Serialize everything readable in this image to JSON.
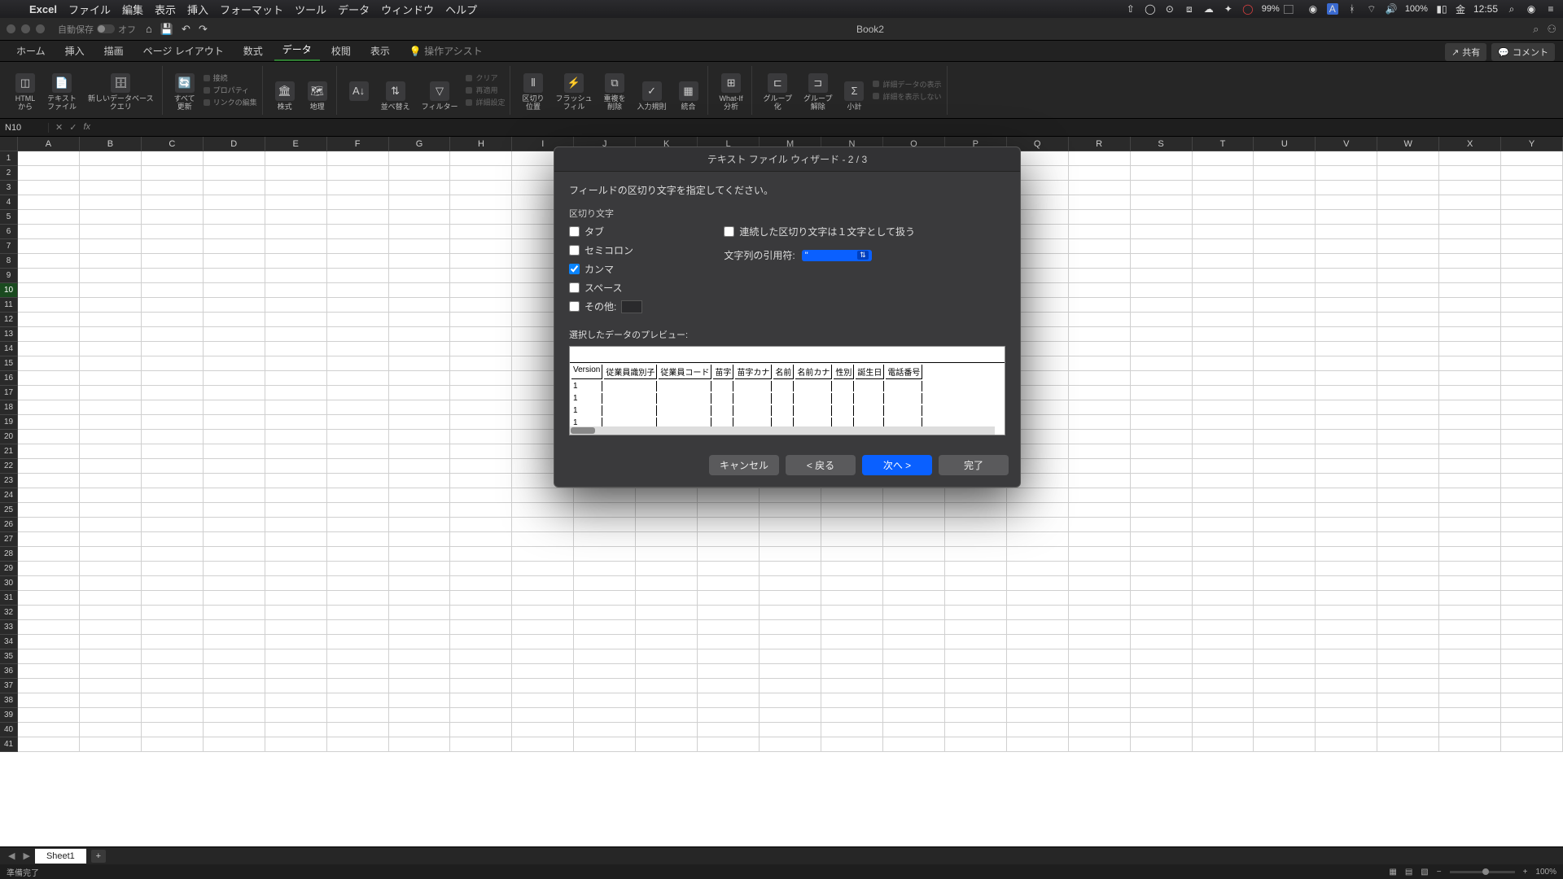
{
  "menubar": {
    "app": "Excel",
    "items": [
      "ファイル",
      "編集",
      "表示",
      "挿入",
      "フォーマット",
      "ツール",
      "データ",
      "ウィンドウ",
      "ヘルプ"
    ],
    "battery_pct": "99%",
    "battery2": "100%",
    "day": "金",
    "time": "12:55"
  },
  "window": {
    "title": "Book2",
    "autosave_label": "自動保存",
    "autosave_state": "オフ"
  },
  "tabs": {
    "items": [
      "ホーム",
      "挿入",
      "描画",
      "ページ レイアウト",
      "数式",
      "データ",
      "校閲",
      "表示"
    ],
    "active": "データ",
    "assist": "操作アシスト",
    "share": "共有",
    "comment": "コメント"
  },
  "ribbon": {
    "g1": {
      "html": "HTML\nから",
      "text": "テキスト\nファイル",
      "db": "新しいデータベース\nクエリ"
    },
    "g1_side": {
      "a": "接続",
      "b": "プロパティ",
      "c": "リンクの編集"
    },
    "g1_refresh": "すべて\n更新",
    "g2": {
      "stock": "株式",
      "geo": "地理"
    },
    "g3": {
      "sort": "並べ替え",
      "filter": "フィルター",
      "clear": "クリア",
      "reapply": "再適用",
      "adv": "詳細設定"
    },
    "g4": {
      "split": "区切り\n位置",
      "flash": "フラッシュ\nフィル",
      "dup": "重複を\n削除",
      "valid": "入力規則",
      "consol": "統合"
    },
    "g5": {
      "whatif": "What-If\n分析"
    },
    "g6": {
      "group": "グループ\n化",
      "ungroup": "グループ\n解除",
      "subtotal": "小計"
    },
    "g6_side": {
      "a": "詳細データの表示",
      "b": "詳細を表示しない"
    }
  },
  "namebox": "N10",
  "columns": [
    "A",
    "B",
    "C",
    "D",
    "E",
    "F",
    "G",
    "H",
    "I",
    "J",
    "K",
    "L",
    "M",
    "N",
    "O",
    "P",
    "Q",
    "R",
    "S",
    "T",
    "U",
    "V",
    "W",
    "X",
    "Y"
  ],
  "row_count": 41,
  "selected_row": 10,
  "sheet": {
    "name": "Sheet1"
  },
  "status": {
    "ready": "準備完了",
    "zoom": "100%"
  },
  "dialog": {
    "title": "テキスト ファイル ウィザード - 2 / 3",
    "instruction": "フィールドの区切り文字を指定してください。",
    "delim_label": "区切り文字",
    "delims": {
      "tab": "タブ",
      "semicolon": "セミコロン",
      "comma": "カンマ",
      "space": "スペース",
      "other": "その他:"
    },
    "checked": {
      "tab": false,
      "semicolon": false,
      "comma": true,
      "space": false,
      "other": false,
      "consecutive": false
    },
    "consecutive": "連続した区切り文字は１文字として扱う",
    "quote_label": "文字列の引用符:",
    "quote_value": "\"",
    "preview_label": "選択したデータのプレビュー:",
    "preview_headers": [
      "Version",
      "従業員識別子",
      "従業員コード",
      "苗字",
      "苗字カナ",
      "名前",
      "名前カナ",
      "性別",
      "誕生日",
      "電話番号"
    ],
    "preview_rows": [
      [
        "1",
        "",
        "",
        "",
        "",
        "",
        "",
        "",
        "",
        ""
      ],
      [
        "1",
        "",
        "",
        "",
        "",
        "",
        "",
        "",
        "",
        ""
      ],
      [
        "1",
        "",
        "",
        "",
        "",
        "",
        "",
        "",
        "",
        ""
      ],
      [
        "1",
        "",
        "",
        "",
        "",
        "",
        "",
        "",
        "",
        ""
      ]
    ],
    "buttons": {
      "cancel": "キャンセル",
      "back": "< 戻る",
      "next": "次へ >",
      "finish": "完了"
    }
  }
}
